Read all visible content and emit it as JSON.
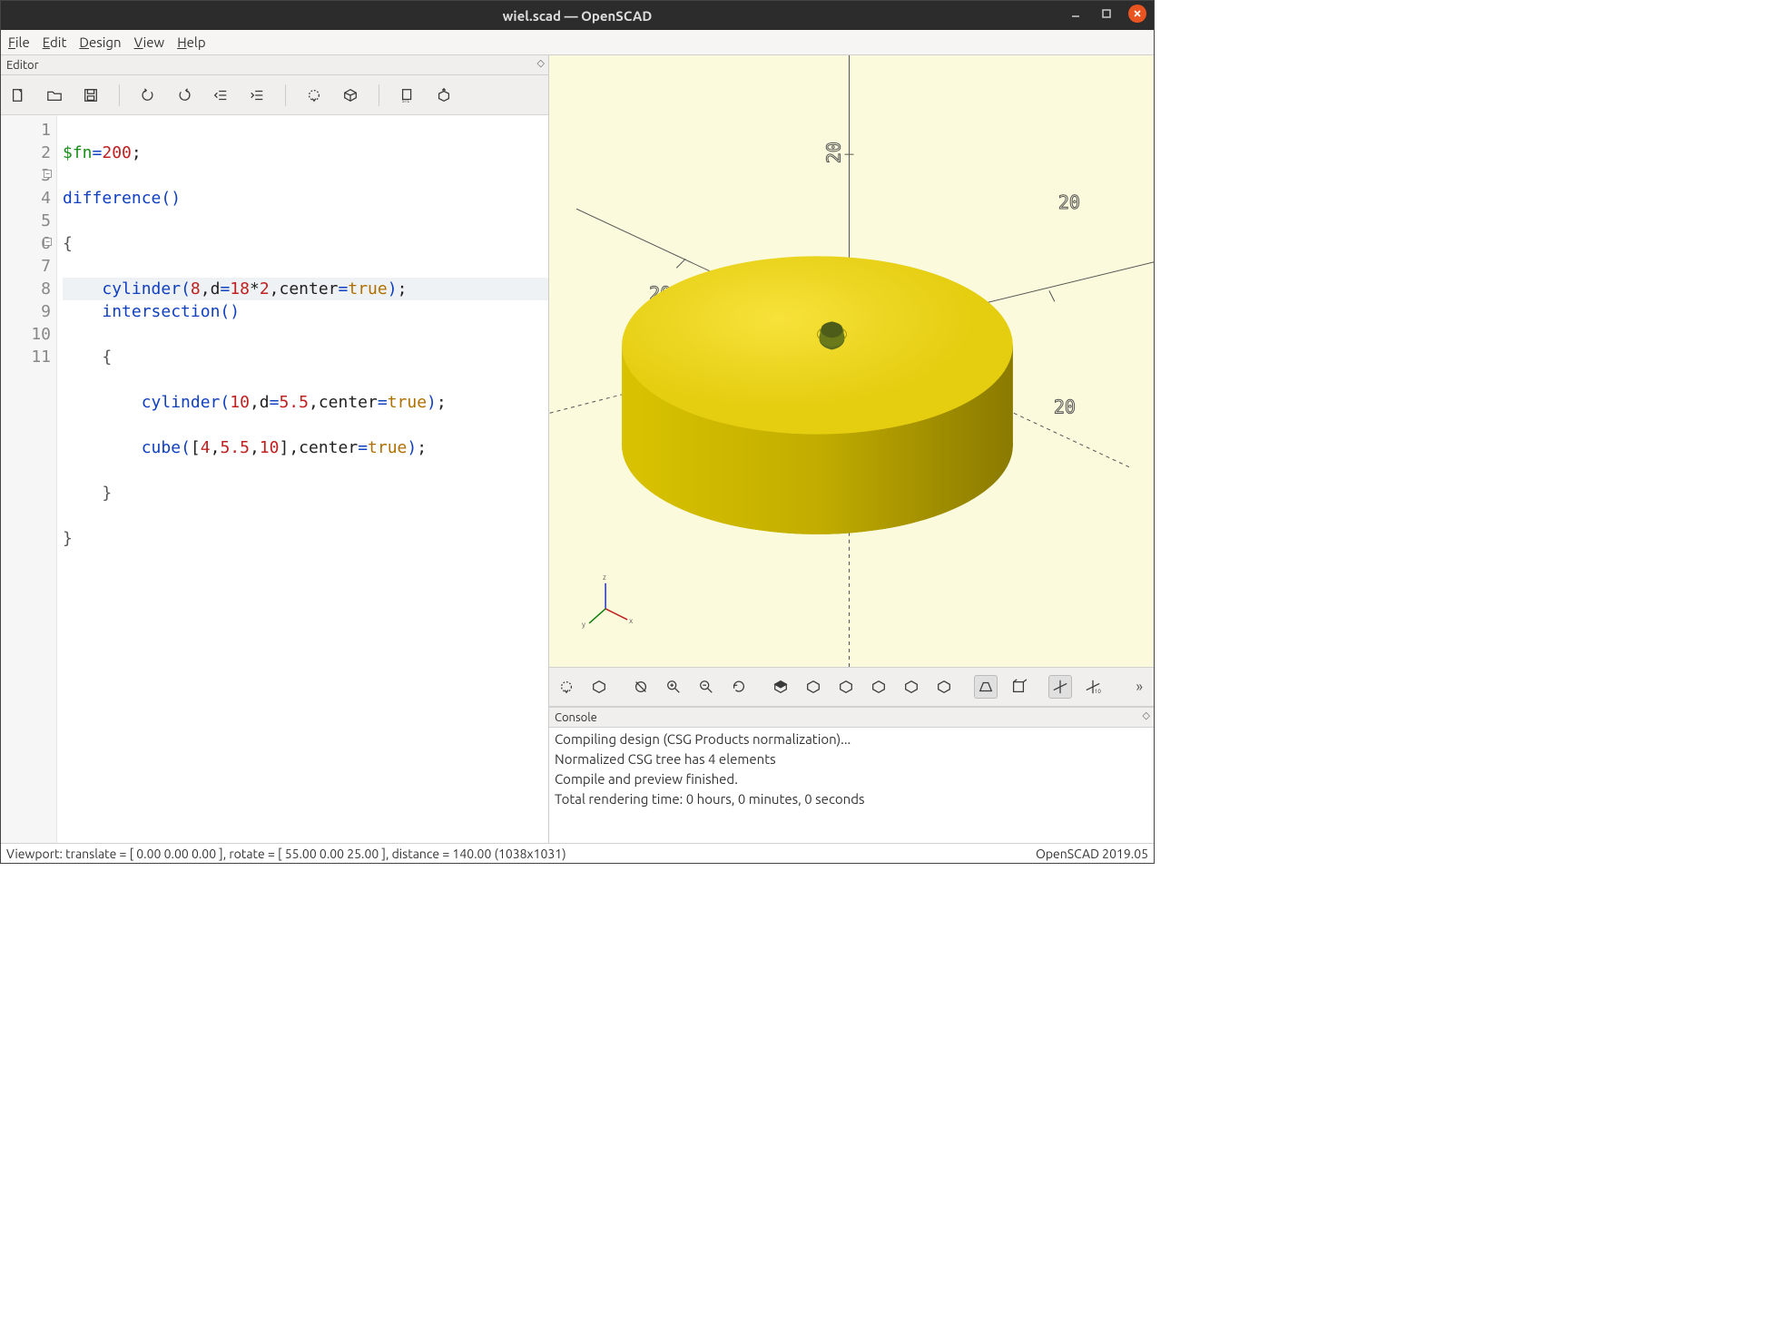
{
  "window": {
    "title": "wiel.scad — OpenSCAD"
  },
  "menubar": {
    "file": "File",
    "edit": "Edit",
    "design": "Design",
    "view": "View",
    "help": "Help"
  },
  "editor": {
    "header": "Editor",
    "code_lines": [
      "$fn=200;",
      "difference()",
      "{",
      "    cylinder(8,d=18*2,center=true);",
      "    intersection()",
      "    {",
      "        cylinder(10,d=5.5,center=true);",
      "        cube([4,5.5,10],center=true);",
      "    }",
      "}",
      ""
    ],
    "line_count": 11,
    "highlighted_line": 4
  },
  "viewport": {
    "axis_ticks": [
      "20",
      "20",
      "20",
      "20"
    ],
    "model": "yellow-wheel-cylinder-with-center-cutout"
  },
  "console": {
    "header": "Console",
    "lines": [
      "Compiling design (CSG Products normalization)...",
      "Normalized CSG tree has 4 elements",
      "Compile and preview finished.",
      "Total rendering time: 0 hours, 0 minutes, 0 seconds"
    ]
  },
  "statusbar": {
    "left": "Viewport: translate = [ 0.00 0.00 0.00 ], rotate = [ 55.00 0.00 25.00 ], distance = 140.00 (1038x1031)",
    "right": "OpenSCAD 2019.05"
  }
}
